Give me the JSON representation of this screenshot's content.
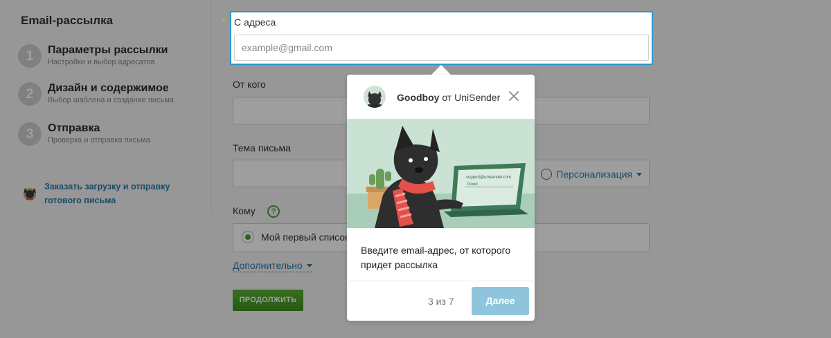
{
  "sidebar": {
    "title": "Email-рассылка",
    "steps": [
      {
        "num": "1",
        "title": "Параметры рассылки",
        "subtitle": "Настройки и выбор адресатов"
      },
      {
        "num": "2",
        "title": "Дизайн и содержимое",
        "subtitle": "Выбор шаблона и создание письма"
      },
      {
        "num": "3",
        "title": "Отправка",
        "subtitle": "Проверка и отправка письма"
      }
    ],
    "order_link": "Заказать загрузку и отправку готового письма"
  },
  "form": {
    "from_address": {
      "label": "С адреса",
      "placeholder": "example@gmail.com"
    },
    "from_name": {
      "label": "От кого"
    },
    "subject": {
      "label": "Тема письма",
      "personalization": "Персонализация"
    },
    "to": {
      "label": "Кому",
      "help": "?",
      "list_option": "Мой первый список"
    },
    "advanced_link": "Дополнительно",
    "continue_button": "ПРОДОЛЖИТЬ"
  },
  "popup": {
    "author_bold": "Goodboy",
    "author_rest": " от UniSender",
    "illustration_email": "support@unisender.com",
    "illustration_word": "Good",
    "message": "Введите email-адрес, от которого придет рассылка",
    "counter": "3 из 7",
    "next_button": "Далее"
  },
  "colors": {
    "accent_blue": "#2c97c9",
    "link_blue": "#2a7aa8",
    "continue_green": "#4a9e2f",
    "next_button": "#8ec5dc"
  }
}
